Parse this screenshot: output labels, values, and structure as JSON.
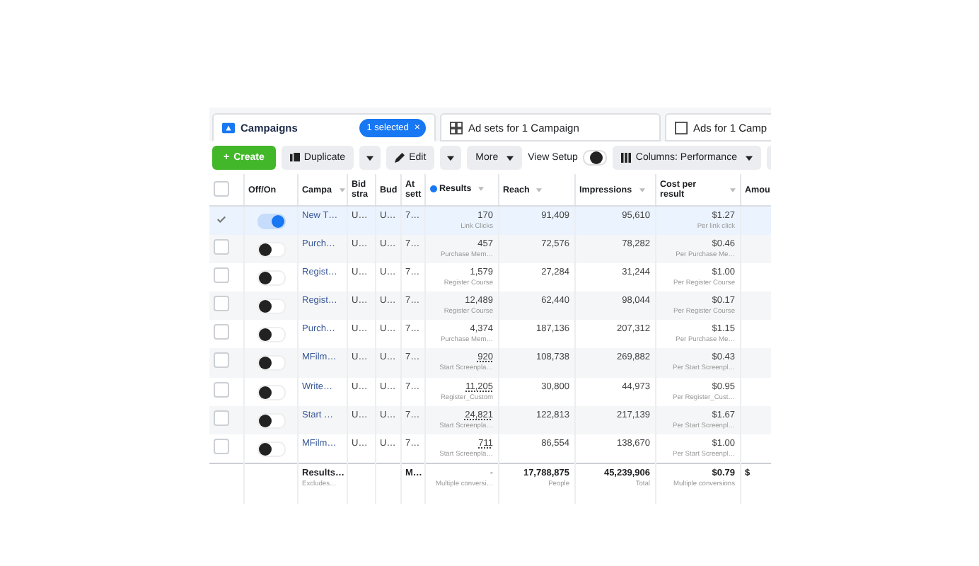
{
  "tabs": [
    {
      "label": "Campaigns",
      "selected": true,
      "badge": "1 selected",
      "badge_close": "×"
    },
    {
      "label": "Ad sets for 1 Campaign",
      "selected": false
    },
    {
      "label": "Ads for 1 Camp",
      "selected": false
    }
  ],
  "toolbar": {
    "create": "Create",
    "create_icon": "+",
    "duplicate": "Duplicate",
    "edit": "Edit",
    "more": "More",
    "view_setup": "View Setup",
    "view_setup_on": false,
    "columns": "Columns: Performance"
  },
  "table": {
    "select_all": false,
    "columns": [
      {
        "label": "Off/On"
      },
      {
        "label": "Campa",
        "sortable": true
      },
      {
        "label": "Bid stra"
      },
      {
        "label": "Bud"
      },
      {
        "label": "At sett"
      },
      {
        "label": "Results",
        "info": true,
        "sortable": true
      },
      {
        "label": "Reach",
        "sortable": true
      },
      {
        "label": "Impressions",
        "sortable": true
      },
      {
        "label": "Cost per result",
        "sortable": true
      },
      {
        "label": "Amou"
      }
    ],
    "rows": [
      {
        "selected": true,
        "on": true,
        "name": "New T…",
        "bid": "U…",
        "budget": "U…",
        "attribution": "7…",
        "results": "170",
        "results_note": "Link Clicks",
        "underlined": false,
        "reach": "91,409",
        "impressions": "95,610",
        "cost": "$1.27",
        "cost_note": "Per link click"
      },
      {
        "selected": false,
        "on": false,
        "name": "Purch…",
        "bid": "U…",
        "budget": "U…",
        "attribution": "7…",
        "results": "457",
        "results_note": "Purchase Mem…",
        "underlined": false,
        "reach": "72,576",
        "impressions": "78,282",
        "cost": "$0.46",
        "cost_note": "Per Purchase Me…"
      },
      {
        "selected": false,
        "on": false,
        "name": "Regist…",
        "bid": "U…",
        "budget": "U…",
        "attribution": "7…",
        "results": "1,579",
        "results_note": "Register Course",
        "underlined": false,
        "reach": "27,284",
        "impressions": "31,244",
        "cost": "$1.00",
        "cost_note": "Per Register Course"
      },
      {
        "selected": false,
        "on": false,
        "name": "Regist…",
        "bid": "U…",
        "budget": "U…",
        "attribution": "7…",
        "results": "12,489",
        "results_note": "Register Course",
        "underlined": false,
        "reach": "62,440",
        "impressions": "98,044",
        "cost": "$0.17",
        "cost_note": "Per Register Course"
      },
      {
        "selected": false,
        "on": false,
        "name": "Purch…",
        "bid": "U…",
        "budget": "U…",
        "attribution": "7…",
        "results": "4,374",
        "results_note": "Purchase Mem…",
        "underlined": false,
        "reach": "187,136",
        "impressions": "207,312",
        "cost": "$1.15",
        "cost_note": "Per Purchase Me…"
      },
      {
        "selected": false,
        "on": false,
        "name": "MFilm…",
        "bid": "U…",
        "budget": "U…",
        "attribution": "7…",
        "results": "920",
        "results_note": "Start Screenpla…",
        "underlined": true,
        "reach": "108,738",
        "impressions": "269,882",
        "cost": "$0.43",
        "cost_note": "Per Start Screenpl…"
      },
      {
        "selected": false,
        "on": false,
        "name": "Write…",
        "bid": "U…",
        "budget": "U…",
        "attribution": "7…",
        "results": "11,205",
        "results_note": "Register_Custom",
        "underlined": true,
        "reach": "30,800",
        "impressions": "44,973",
        "cost": "$0.95",
        "cost_note": "Per Register_Cust…"
      },
      {
        "selected": false,
        "on": false,
        "name": "Start …",
        "bid": "U…",
        "budget": "U…",
        "attribution": "7…",
        "results": "24,821",
        "results_note": "Start Screenpla…",
        "underlined": true,
        "reach": "122,813",
        "impressions": "217,139",
        "cost": "$1.67",
        "cost_note": "Per Start Screenpl…"
      },
      {
        "selected": false,
        "on": false,
        "name": "MFilm…",
        "bid": "U…",
        "budget": "U…",
        "attribution": "7…",
        "results": "711",
        "results_note": "Start Screenpla…",
        "underlined": true,
        "reach": "86,554",
        "impressions": "138,670",
        "cost": "$1.00",
        "cost_note": "Per Start Screenpl…"
      }
    ],
    "footer": {
      "name": "Results…",
      "name_note": "Excludes…",
      "attribution": "M…",
      "results": "-",
      "results_note": "Multiple conversi…",
      "reach": "17,788,875",
      "reach_note": "People",
      "impressions": "45,239,906",
      "impressions_note": "Total",
      "cost": "$0.79",
      "cost_note": "Multiple conversions",
      "amount": "$"
    }
  }
}
